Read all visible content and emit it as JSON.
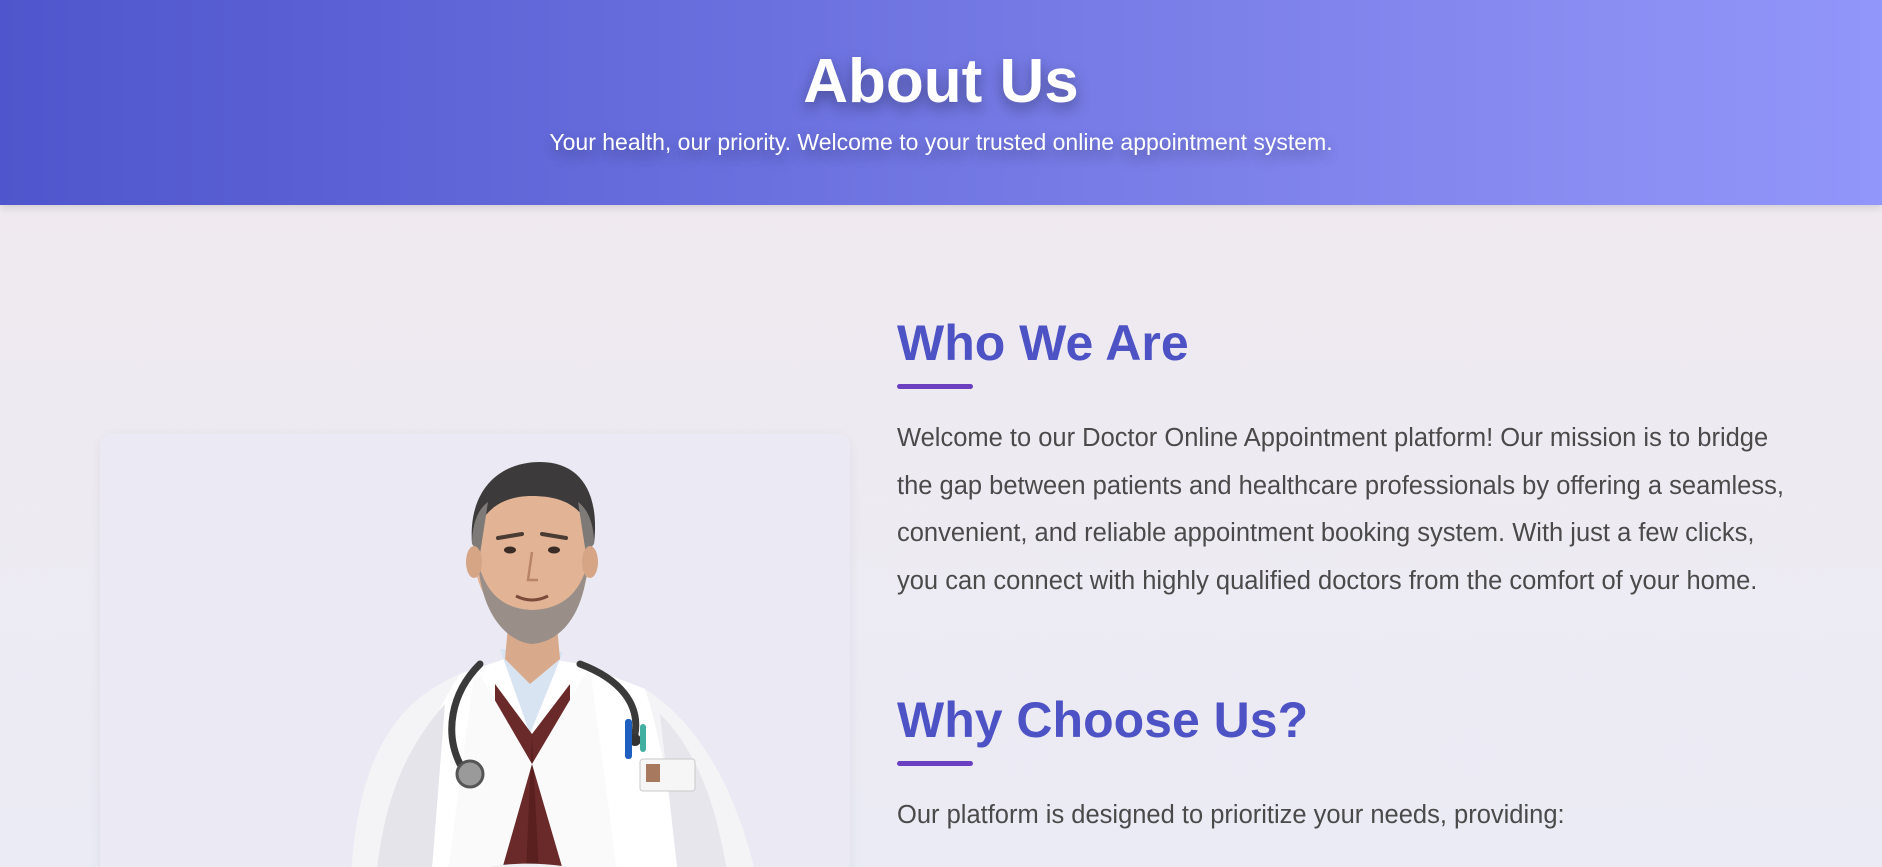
{
  "hero": {
    "title": "About Us",
    "subtitle": "Your health, our priority. Welcome to your trusted online appointment system."
  },
  "about": {
    "who_heading": "Who We Are",
    "who_text": "Welcome to our Doctor Online Appointment platform! Our mission is to bridge the gap between patients and healthcare professionals by offering a seamless, convenient, and reliable appointment booking system. With just a few clicks, you can connect with highly qualified doctors from the comfort of your home.",
    "why_heading": "Why Choose Us?",
    "why_text": "Our platform is designed to prioritize your needs, providing:"
  },
  "colors": {
    "header_gradient_start": "#4f55cc",
    "header_gradient_end": "#9196fb",
    "heading": "#4d52c4",
    "underline": "#6a3fc0",
    "body_text": "#4a4a4a",
    "page_background": "#efeaf0"
  },
  "image": {
    "subject": "doctor-photo"
  }
}
